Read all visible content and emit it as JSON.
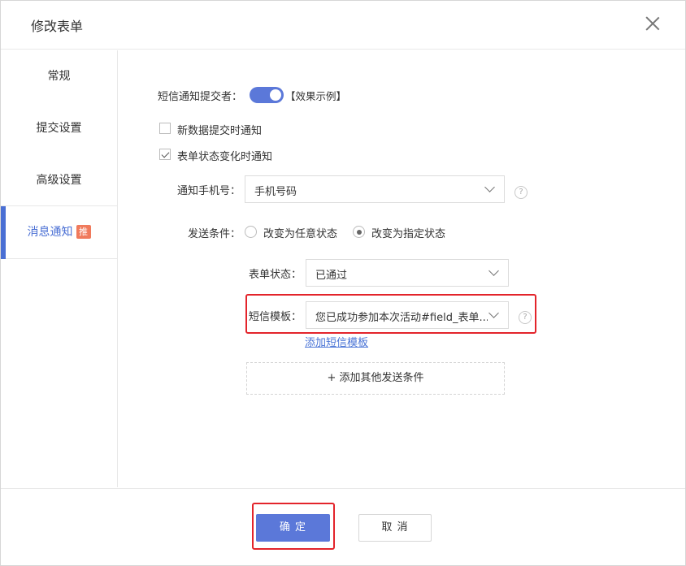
{
  "dialog": {
    "title": "修改表单"
  },
  "sidebar": {
    "items": [
      {
        "label": "常规"
      },
      {
        "label": "提交设置"
      },
      {
        "label": "高级设置"
      },
      {
        "label": "消息通知",
        "badge": "推",
        "active": true
      }
    ]
  },
  "form": {
    "sms_notify_label": "短信通知提交者：",
    "sms_notify_on": true,
    "example_link": "【效果示例】",
    "checkbox_new_data": {
      "label": "新数据提交时通知",
      "checked": false
    },
    "checkbox_status_change": {
      "label": "表单状态变化时通知",
      "checked": true
    },
    "phone_label": "通知手机号：",
    "phone_value": "手机号码",
    "send_condition_label": "发送条件：",
    "radio_any": {
      "label": "改变为任意状态",
      "checked": false
    },
    "radio_specified": {
      "label": "改变为指定状态",
      "checked": true
    },
    "form_status_label": "表单状态：",
    "form_status_value": "已通过",
    "sms_template_label": "短信模板：",
    "sms_template_value": "您已成功参加本次活动#field_表单...",
    "add_template_link": "添加短信模板",
    "add_condition": "+ 添加其他发送条件",
    "help_glyph": "?"
  },
  "footer": {
    "ok_label": "确 定",
    "cancel_label": "取 消"
  },
  "colors": {
    "primary": "#5b78d9",
    "highlight_box": "#e3242b",
    "badge": "#f07a5c"
  }
}
